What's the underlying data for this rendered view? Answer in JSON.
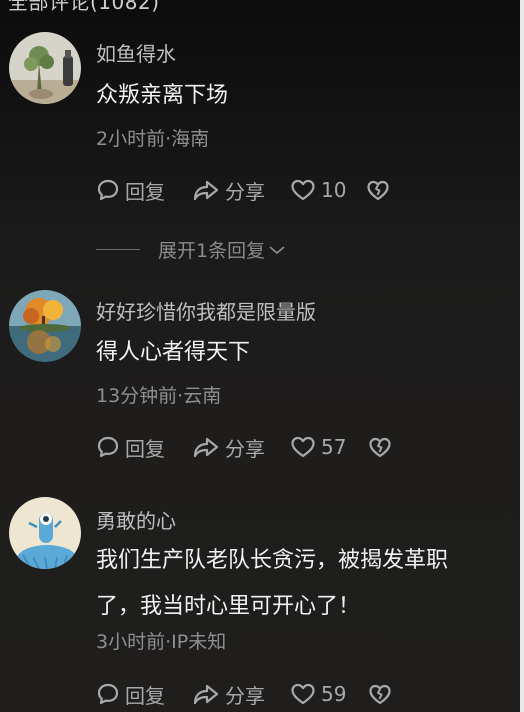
{
  "header": {
    "title": "全部评论(1082)"
  },
  "comments": [
    {
      "username": "如鱼得水",
      "content": "众叛亲离下场",
      "meta": "2小时前·海南",
      "reply_label": "回复",
      "share_label": "分享",
      "likes": "10",
      "expand_label": "展开1条回复"
    },
    {
      "username": "好好珍惜你我都是限量版",
      "content": "得人心者得天下",
      "meta": "13分钟前·云南",
      "reply_label": "回复",
      "share_label": "分享",
      "likes": "57"
    },
    {
      "username": "勇敢的心",
      "content_lines": [
        "我们生产队老队长贪污，被揭发革职",
        "了，我当时心里可开心了！"
      ],
      "meta": "3小时前·IP未知",
      "reply_label": "回复",
      "share_label": "分享",
      "likes": "59"
    }
  ],
  "icons": {
    "reply": "speech-bubble-icon",
    "share": "share-arrow-icon",
    "like": "heart-icon",
    "dislike": "broken-heart-icon",
    "expand": "chevron-down-icon"
  }
}
